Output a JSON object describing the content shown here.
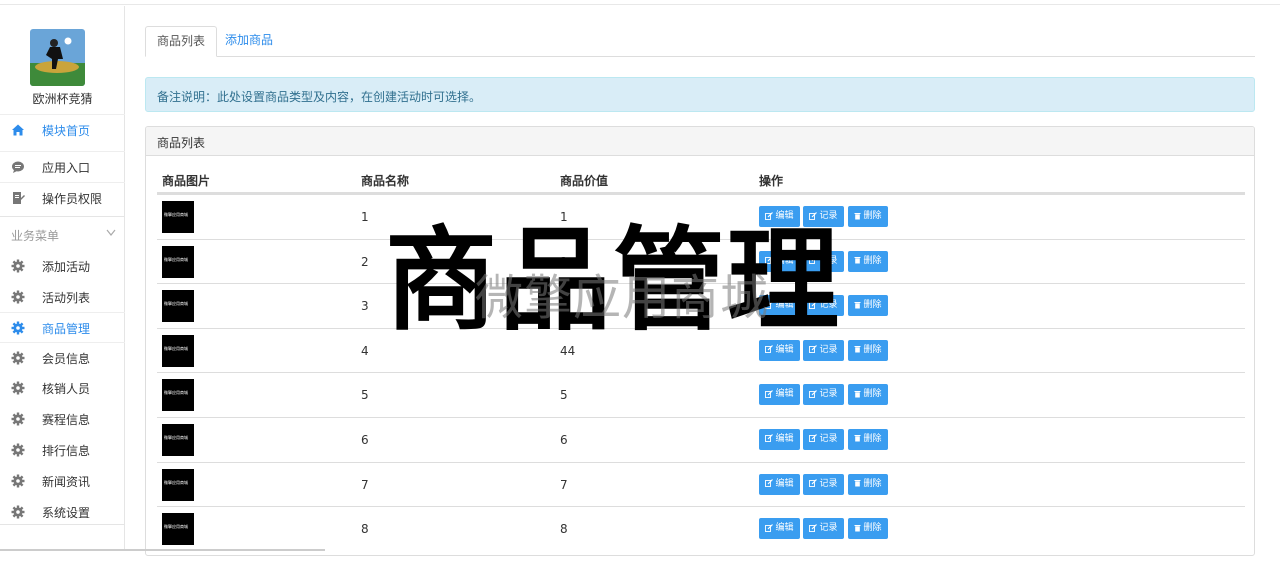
{
  "sidebar": {
    "app_name": "欧洲杯竞猜",
    "top_items": [
      {
        "label": "模块首页",
        "active": true,
        "icon": "home-icon"
      },
      {
        "label": "应用入口",
        "active": false,
        "icon": "chat-icon"
      },
      {
        "label": "操作员权限",
        "active": false,
        "icon": "edit-doc-icon"
      }
    ],
    "menu_header": "业务菜单",
    "menu_items": [
      {
        "label": "添加活动",
        "active": false
      },
      {
        "label": "活动列表",
        "active": false
      },
      {
        "label": "商品管理",
        "active": true
      },
      {
        "label": "会员信息",
        "active": false
      },
      {
        "label": "核销人员",
        "active": false
      },
      {
        "label": "赛程信息",
        "active": false
      },
      {
        "label": "排行信息",
        "active": false
      },
      {
        "label": "新闻资讯",
        "active": false
      },
      {
        "label": "系统设置",
        "active": false
      }
    ]
  },
  "tabs": [
    {
      "label": "商品列表",
      "active": true
    },
    {
      "label": "添加商品",
      "active": false
    }
  ],
  "alert": "备注说明：此处设置商品类型及内容，在创建活动时可选择。",
  "panel": {
    "title": "商品列表",
    "columns": [
      "商品图片",
      "商品名称",
      "商品价值",
      "操作"
    ],
    "rows": [
      {
        "name": "1",
        "value": "1"
      },
      {
        "name": "2",
        "value": "2"
      },
      {
        "name": "3",
        "value": "3"
      },
      {
        "name": "4",
        "value": "44"
      },
      {
        "name": "5",
        "value": "5"
      },
      {
        "name": "6",
        "value": "6"
      },
      {
        "name": "7",
        "value": "7"
      },
      {
        "name": "8",
        "value": "8"
      }
    ],
    "actions": {
      "edit": "编辑",
      "record": "记录",
      "delete": "删除"
    }
  },
  "watermark": {
    "big": "商品管理",
    "faint": "微擎应用商城"
  },
  "colors": {
    "accent": "#2d8ceb",
    "button": "#3a9df0",
    "alert_bg": "#d9edf7"
  }
}
